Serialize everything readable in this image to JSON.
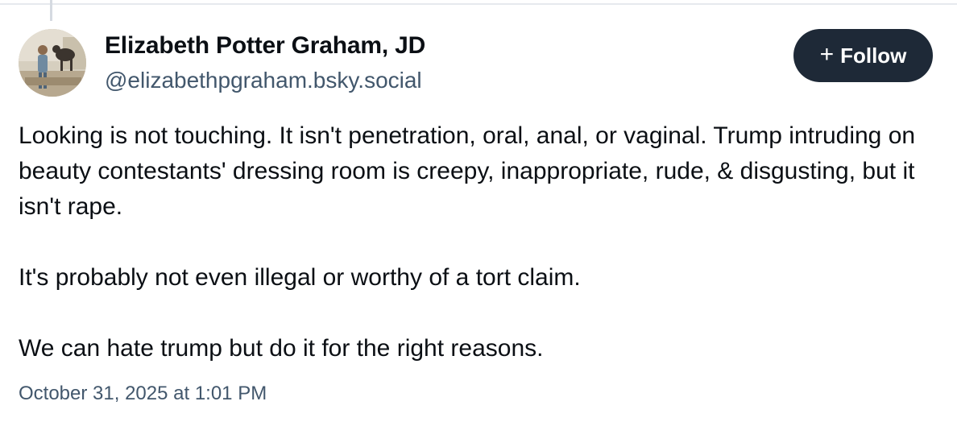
{
  "author": {
    "display_name": "Elizabeth Potter Graham, JD",
    "handle": "@elizabethpgraham.bsky.social",
    "avatar_icon": "profile-photo"
  },
  "follow_button": {
    "icon": "plus-icon",
    "icon_glyph": "+",
    "label": "Follow"
  },
  "post": {
    "paragraphs": [
      "Looking is not touching. It isn't penetration, oral, anal, or vaginal. Trump intruding on beauty contestants' dressing room is creepy, inappropriate, rude, & disgusting, but it isn't rape.",
      "It's probably not even illegal or worthy of a tort claim.",
      "We can hate trump but do it for the right reasons."
    ],
    "timestamp": "October 31, 2025 at 1:01 PM"
  },
  "colors": {
    "follow_button_bg": "#1e2937",
    "handle_text": "#42576c",
    "body_text": "#0b0f14",
    "divider": "#e6e9ee"
  }
}
